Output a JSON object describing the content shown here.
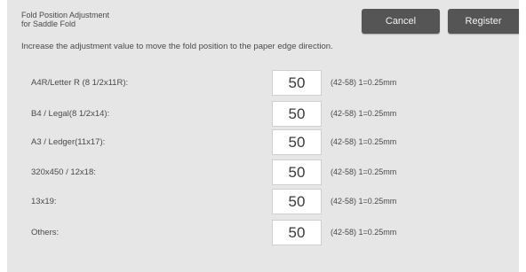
{
  "header": {
    "title_line1": "Fold Position Adjustment",
    "title_line2": "for Saddle Fold",
    "cancel_label": "Cancel",
    "register_label": "Register"
  },
  "instruction": "Increase the adjustment value to move the fold position to the paper edge direction.",
  "rows": [
    {
      "label": "A4R/Letter R (8 1/2x11R):",
      "value": "50",
      "range": "(42-58) 1=0.25mm"
    },
    {
      "label": "B4 / Legal(8 1/2x14):",
      "value": "50",
      "range": "(42-58) 1=0.25mm"
    },
    {
      "label": "A3 / Ledger(11x17):",
      "value": "50",
      "range": "(42-58) 1=0.25mm"
    },
    {
      "label": "320x450 / 12x18:",
      "value": "50",
      "range": "(42-58) 1=0.25mm"
    },
    {
      "label": "13x19:",
      "value": "50",
      "range": "(42-58) 1=0.25mm"
    },
    {
      "label": "Others:",
      "value": "50",
      "range": "(42-58) 1=0.25mm"
    }
  ],
  "colors": {
    "background": "#e6e6e6",
    "button": "#555555",
    "button_text": "#f2f2f2",
    "input_bg": "#ffffff",
    "text": "#4a4a4a"
  }
}
